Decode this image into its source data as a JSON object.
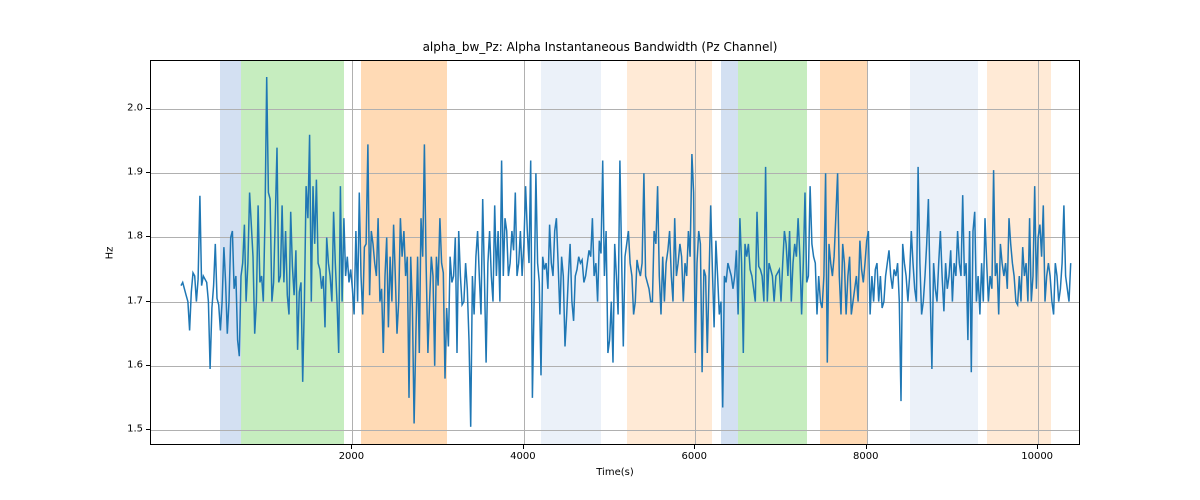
{
  "chart_data": {
    "type": "line",
    "title": "alpha_bw_Pz: Alpha Instantaneous Bandwidth (Pz Channel)",
    "xlabel": "Time(s)",
    "ylabel": "Hz",
    "xlim": [
      -350,
      10500
    ],
    "ylim": [
      1.475,
      2.075
    ],
    "xticks": [
      2000,
      4000,
      6000,
      8000,
      10000
    ],
    "yticks": [
      1.5,
      1.6,
      1.7,
      1.8,
      1.9,
      2.0
    ],
    "grid": true,
    "bands": [
      {
        "x0": 450,
        "x1": 700,
        "color": "#aec7e8",
        "alpha": 0.55
      },
      {
        "x0": 700,
        "x1": 1900,
        "color": "#98df8a",
        "alpha": 0.55
      },
      {
        "x0": 2100,
        "x1": 3100,
        "color": "#ffbb78",
        "alpha": 0.55
      },
      {
        "x0": 4200,
        "x1": 4900,
        "color": "#aec7e8",
        "alpha": 0.25
      },
      {
        "x0": 5200,
        "x1": 6200,
        "color": "#ffbb78",
        "alpha": 0.3
      },
      {
        "x0": 6300,
        "x1": 6500,
        "color": "#aec7e8",
        "alpha": 0.55
      },
      {
        "x0": 6500,
        "x1": 7300,
        "color": "#98df8a",
        "alpha": 0.55
      },
      {
        "x0": 7450,
        "x1": 8000,
        "color": "#ffbb78",
        "alpha": 0.55
      },
      {
        "x0": 8500,
        "x1": 9300,
        "color": "#aec7e8",
        "alpha": 0.25
      },
      {
        "x0": 9400,
        "x1": 10150,
        "color": "#ffbb78",
        "alpha": 0.3
      }
    ],
    "line_color": "#1f77b4",
    "line_width": 1.5,
    "series": [
      {
        "name": "alpha_bw_Pz",
        "x_start": 0,
        "x_step": 20,
        "y": [
          1.725,
          1.73,
          1.72,
          1.71,
          1.7,
          1.655,
          1.715,
          1.745,
          1.74,
          1.7,
          1.735,
          1.865,
          1.725,
          1.74,
          1.735,
          1.73,
          1.7,
          1.595,
          1.69,
          1.725,
          1.79,
          1.705,
          1.695,
          1.655,
          1.7,
          1.785,
          1.73,
          1.65,
          1.7,
          1.8,
          1.81,
          1.72,
          1.74,
          1.64,
          1.615,
          1.74,
          1.76,
          1.82,
          1.7,
          1.76,
          1.87,
          1.82,
          1.77,
          1.65,
          1.7,
          1.85,
          1.73,
          1.74,
          1.7,
          1.83,
          2.05,
          1.87,
          1.86,
          1.7,
          1.73,
          1.83,
          1.94,
          1.73,
          1.74,
          1.85,
          1.73,
          1.81,
          1.71,
          1.68,
          1.84,
          1.755,
          1.71,
          1.78,
          1.625,
          1.715,
          1.73,
          1.575,
          1.7,
          1.88,
          1.83,
          1.96,
          1.7,
          1.88,
          1.79,
          1.89,
          1.76,
          1.75,
          1.72,
          1.74,
          1.66,
          1.8,
          1.76,
          1.74,
          1.7,
          1.84,
          1.76,
          1.7,
          1.62,
          1.88,
          1.7,
          1.83,
          1.74,
          1.77,
          1.73,
          1.75,
          1.72,
          1.68,
          1.81,
          1.7,
          1.87,
          1.74,
          1.68,
          1.785,
          1.79,
          1.945,
          1.71,
          1.81,
          1.79,
          1.76,
          1.74,
          1.83,
          1.7,
          1.72,
          1.62,
          1.74,
          1.8,
          1.66,
          1.77,
          1.7,
          1.82,
          1.74,
          1.65,
          1.7,
          1.83,
          1.77,
          1.81,
          1.74,
          1.77,
          1.55,
          1.77,
          1.69,
          1.51,
          1.65,
          1.77,
          1.62,
          1.83,
          1.77,
          1.945,
          1.76,
          1.62,
          1.7,
          1.77,
          1.74,
          1.6,
          1.77,
          1.725,
          1.83,
          1.76,
          1.745,
          1.58,
          1.69,
          1.63,
          1.77,
          1.73,
          1.74,
          1.8,
          1.62,
          1.81,
          1.74,
          1.695,
          1.7,
          1.76,
          1.72,
          1.64,
          1.505,
          1.74,
          1.68,
          1.77,
          1.81,
          1.74,
          1.68,
          1.86,
          1.74,
          1.605,
          1.76,
          1.81,
          1.74,
          1.7,
          1.85,
          1.74,
          1.81,
          1.7,
          1.92,
          1.74,
          1.83,
          1.81,
          1.74,
          1.76,
          1.81,
          1.78,
          1.87,
          1.74,
          1.76,
          1.81,
          1.74,
          1.79,
          1.88,
          1.81,
          1.76,
          1.92,
          1.55,
          1.7,
          1.9,
          1.76,
          1.73,
          1.585,
          1.77,
          1.75,
          1.76,
          1.72,
          1.82,
          1.76,
          1.74,
          1.81,
          1.83,
          1.76,
          1.68,
          1.77,
          1.74,
          1.63,
          1.68,
          1.74,
          1.79,
          1.7,
          1.67,
          1.74,
          1.75,
          1.77,
          1.76,
          1.765,
          1.73,
          1.74,
          1.76,
          1.78,
          1.77,
          1.83,
          1.74,
          1.76,
          1.7,
          1.795,
          1.775,
          1.92,
          1.74,
          1.81,
          1.62,
          1.64,
          1.7,
          1.605,
          1.79,
          1.74,
          1.68,
          1.92,
          1.77,
          1.63,
          1.77,
          1.79,
          1.81,
          1.76,
          1.74,
          1.68,
          1.7,
          1.765,
          1.75,
          1.74,
          1.76,
          1.9,
          1.74,
          1.73,
          1.72,
          1.7,
          1.7,
          1.81,
          1.79,
          1.88,
          1.74,
          1.68,
          1.77,
          1.7,
          1.76,
          1.78,
          1.81,
          1.74,
          1.7,
          1.83,
          1.74,
          1.76,
          1.79,
          1.77,
          1.7,
          1.76,
          1.74,
          1.81,
          1.77,
          1.93,
          1.87,
          1.62,
          1.76,
          1.81,
          1.79,
          1.59,
          1.75,
          1.74,
          1.62,
          1.735,
          1.85,
          1.75,
          1.66,
          1.795,
          1.74,
          1.68,
          1.7,
          1.535,
          1.74,
          1.73,
          1.76,
          1.75,
          1.74,
          1.72,
          1.74,
          1.78,
          1.68,
          1.83,
          1.76,
          1.62,
          1.79,
          1.77,
          1.79,
          1.75,
          1.74,
          1.72,
          1.7,
          1.84,
          1.755,
          1.75,
          1.74,
          1.7,
          1.91,
          1.7,
          1.76,
          1.75,
          1.74,
          1.7,
          1.74,
          1.745,
          1.75,
          1.7,
          1.76,
          1.81,
          1.79,
          1.74,
          1.81,
          1.7,
          1.76,
          1.79,
          1.77,
          1.83,
          1.77,
          1.68,
          1.76,
          1.87,
          1.73,
          1.74,
          1.88,
          1.79,
          1.77,
          1.76,
          1.68,
          1.74,
          1.7,
          1.69,
          1.74,
          1.9,
          1.605,
          1.79,
          1.76,
          1.74,
          1.77,
          1.835,
          1.9,
          1.74,
          1.68,
          1.79,
          1.76,
          1.68,
          1.74,
          1.77,
          1.68,
          1.7,
          1.72,
          1.74,
          1.7,
          1.795,
          1.75,
          1.73,
          1.76,
          1.795,
          1.81,
          1.68,
          1.74,
          1.7,
          1.75,
          1.76,
          1.7,
          1.74,
          1.69,
          1.7,
          1.74,
          1.76,
          1.78,
          1.74,
          1.72,
          1.75,
          1.74,
          1.76,
          1.7,
          1.545,
          1.79,
          1.76,
          1.74,
          1.7,
          1.74,
          1.81,
          1.76,
          1.72,
          1.7,
          1.91,
          1.76,
          1.68,
          1.7,
          1.74,
          1.79,
          1.86,
          1.72,
          1.595,
          1.76,
          1.72,
          1.7,
          1.76,
          1.81,
          1.74,
          1.685,
          1.76,
          1.72,
          1.74,
          1.78,
          1.7,
          1.76,
          1.74,
          1.81,
          1.76,
          1.74,
          1.866,
          1.74,
          1.76,
          1.64,
          1.81,
          1.59,
          1.81,
          1.84,
          1.7,
          1.74,
          1.68,
          1.76,
          1.7,
          1.83,
          1.76,
          1.7,
          1.74,
          1.72,
          1.905,
          1.74,
          1.76,
          1.68,
          1.79,
          1.76,
          1.74,
          1.76,
          1.72,
          1.83,
          1.79,
          1.76,
          1.74,
          1.7,
          1.695,
          1.74,
          1.7,
          1.785,
          1.74,
          1.76,
          1.7,
          1.83,
          1.7,
          1.74,
          1.88,
          1.72,
          1.8,
          1.82,
          1.77,
          1.85,
          1.7,
          1.74,
          1.76,
          1.74,
          1.7,
          1.68,
          1.76,
          1.74,
          1.7,
          1.72,
          1.76,
          1.85,
          1.74,
          1.72,
          1.7,
          1.76
        ]
      }
    ]
  },
  "layout": {
    "fig_w": 1200,
    "fig_h": 500,
    "ax_left": 150,
    "ax_top": 60,
    "ax_width": 930,
    "ax_height": 385
  }
}
